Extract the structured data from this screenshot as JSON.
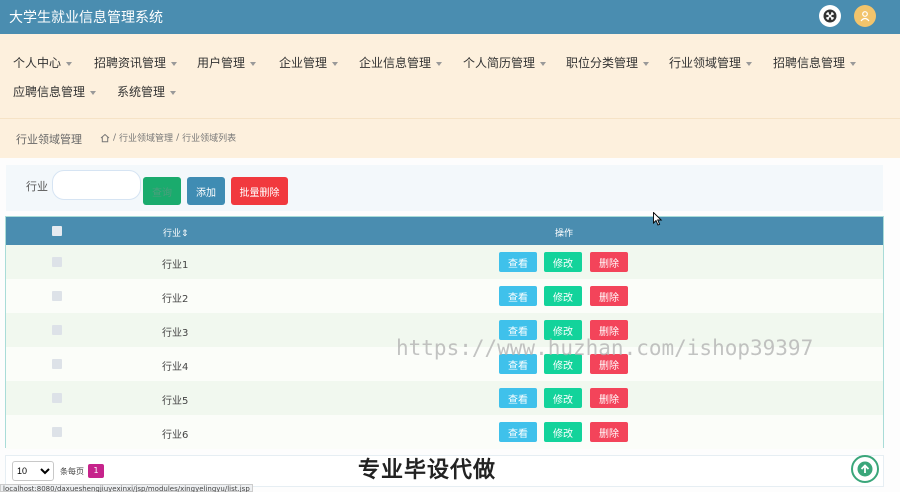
{
  "app": {
    "title": "大学生就业信息管理系统"
  },
  "nav": {
    "row1": [
      "个人中心",
      "招聘资讯管理",
      "用户管理",
      "企业管理",
      "企业信息管理",
      "个人简历管理",
      "职位分类管理",
      "行业领域管理",
      "招聘信息管理"
    ],
    "row2": [
      "应聘信息管理",
      "系统管理"
    ]
  },
  "breadcrumb": {
    "title": "行业领域管理",
    "path": [
      "行业领域管理",
      "行业领域列表"
    ],
    "sep": "/"
  },
  "search": {
    "label": "行业",
    "value": "",
    "placeholder": "",
    "search_label": "查询",
    "add_label": "添加",
    "batch_delete_label": "批量删除"
  },
  "table": {
    "headers": {
      "industry": "行业⇕",
      "actions": "操作"
    },
    "rows": [
      {
        "name": "行业1"
      },
      {
        "name": "行业2"
      },
      {
        "name": "行业3"
      },
      {
        "name": "行业4"
      },
      {
        "name": "行业5"
      },
      {
        "name": "行业6"
      }
    ],
    "actions": {
      "view": "查看",
      "edit": "修改",
      "delete": "删除"
    }
  },
  "pager": {
    "page_size": "10",
    "page_size_options": [
      "10"
    ],
    "per_page_label": "条每页",
    "current_page": "1"
  },
  "overlay": {
    "promo": "专业毕设代做",
    "watermark": "https://www.huzhan.com/ishop39397",
    "status_url": "localhost:8080/daxueshengjiuyexinxi/jsp/modules/xingyelingyu/list.jsp"
  },
  "colors": {
    "header": "#4a8db0",
    "nav_bg": "#fdf0dd",
    "view": "#3fc1eb",
    "edit": "#13d39b",
    "delete": "#f3445a",
    "batch_delete": "#f1393e",
    "add": "#3f8cb3"
  }
}
